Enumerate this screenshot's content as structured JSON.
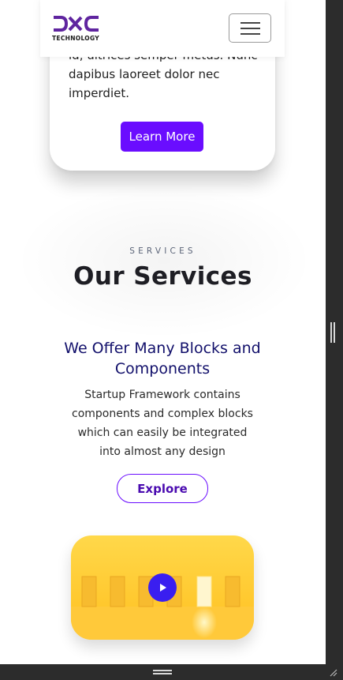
{
  "header": {
    "logo_text": "DXC",
    "logo_subtitle": "TECHNOLOGY",
    "menu_icon": "hamburger-icon"
  },
  "card": {
    "text": "id, ultrices semper metus. Nunc dapibus laoreet dolor nec imperdiet.",
    "button_label": "Learn More"
  },
  "services": {
    "eyebrow": "SERVICES",
    "title": "Our Services",
    "offer_title": "We Offer Many Blocks and Components",
    "offer_text": "Startup Framework contains components and complex blocks which can easily be integrated into almost any design",
    "explore_label": "Explore"
  },
  "video": {
    "play_icon": "play-icon"
  },
  "colors": {
    "accent_purple": "#6a0dff",
    "title_navy": "#12106b",
    "video_yellow": "#ffc93a"
  }
}
